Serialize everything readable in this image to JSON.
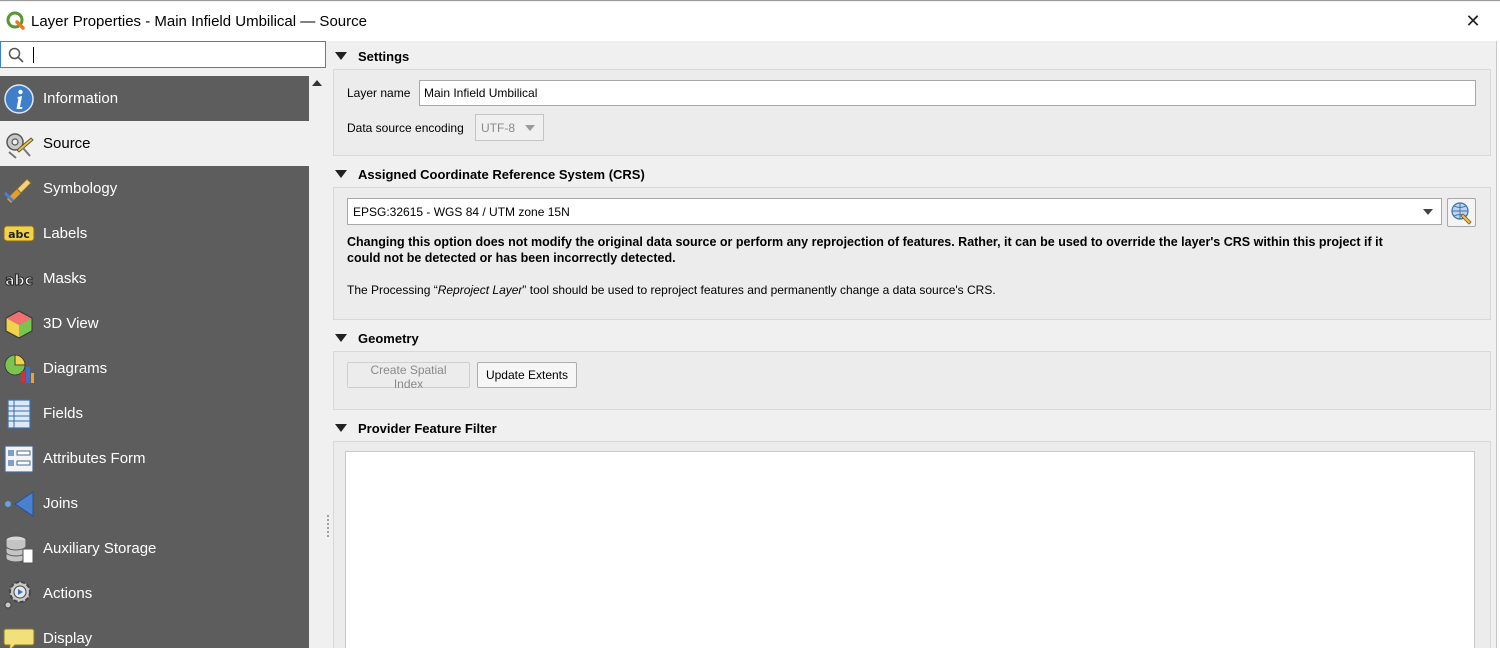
{
  "window": {
    "title": "Layer Properties - Main Infield Umbilical — Source",
    "close_glyph": "✕"
  },
  "search": {
    "value": "",
    "placeholder": ""
  },
  "sidebar": {
    "items": [
      {
        "label": "Information",
        "icon": "information-icon"
      },
      {
        "label": "Source",
        "icon": "source-icon",
        "active": true
      },
      {
        "label": "Symbology",
        "icon": "symbology-icon"
      },
      {
        "label": "Labels",
        "icon": "labels-icon"
      },
      {
        "label": "Masks",
        "icon": "masks-icon"
      },
      {
        "label": "3D View",
        "icon": "3d-view-icon"
      },
      {
        "label": "Diagrams",
        "icon": "diagrams-icon"
      },
      {
        "label": "Fields",
        "icon": "fields-icon"
      },
      {
        "label": "Attributes Form",
        "icon": "attributes-form-icon"
      },
      {
        "label": "Joins",
        "icon": "joins-icon"
      },
      {
        "label": "Auxiliary Storage",
        "icon": "auxiliary-storage-icon"
      },
      {
        "label": "Actions",
        "icon": "actions-icon"
      },
      {
        "label": "Display",
        "icon": "display-icon"
      }
    ]
  },
  "settings": {
    "header": "Settings",
    "layer_name_label": "Layer name",
    "layer_name_value": "Main Infield Umbilical",
    "encoding_label": "Data source encoding",
    "encoding_value": "UTF-8"
  },
  "crs": {
    "header": "Assigned Coordinate Reference System (CRS)",
    "selected": "EPSG:32615 - WGS 84 / UTM zone 15N",
    "warning_line1": "Changing this option does not modify the original data source or perform any reprojection of features. Rather, it can be used to override the layer's CRS within this project if it",
    "warning_line2": "could not be detected or has been incorrectly detected.",
    "info_prefix": "The Processing “",
    "info_tool": "Reproject Layer",
    "info_suffix": "” tool should be used to reproject features and permanently change a data source's CRS."
  },
  "geometry": {
    "header": "Geometry",
    "create_index_label": "Create Spatial Index",
    "update_extents_label": "Update Extents"
  },
  "filter": {
    "header": "Provider Feature Filter",
    "value": ""
  },
  "colors": {
    "sidebar_bg": "#5d5d5d",
    "active_bg": "#f0f0f0",
    "accent": "#3a82d6"
  }
}
